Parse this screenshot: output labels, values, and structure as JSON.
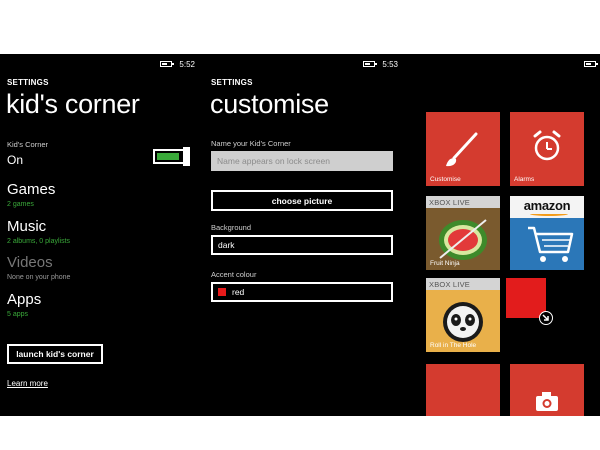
{
  "screen1": {
    "status_time": "5:52",
    "section": "SETTINGS",
    "title": "kid's corner",
    "toggle_label": "Kid's Corner",
    "toggle_state": "On",
    "items": [
      {
        "title": "Games",
        "subtitle": "2 games"
      },
      {
        "title": "Music",
        "subtitle": "2 albums, 0 playlists"
      },
      {
        "title": "Videos",
        "subtitle": "None on your phone"
      },
      {
        "title": "Apps",
        "subtitle": "5 apps"
      }
    ],
    "launch_button": "launch kid's corner",
    "learn_more": "Learn more"
  },
  "screen2": {
    "status_time": "5:53",
    "section": "SETTINGS",
    "title": "customise",
    "name_label": "Name your Kid's Corner",
    "name_placeholder": "Name appears on lock screen",
    "choose_picture": "choose picture",
    "background_label": "Background",
    "background_value": "dark",
    "accent_label": "Accent colour",
    "accent_value": "red"
  },
  "screen3": {
    "tiles": {
      "customise": "Customise",
      "alarms": "Alarms",
      "xbox1_header": "XBOX LIVE",
      "xbox1_label": "Fruit Ninja",
      "amazon_text": "amazon",
      "xbox2_header": "XBOX LIVE",
      "xbox2_label": "Roll in The Hole"
    }
  },
  "colors": {
    "accent_red": "#d43b2f",
    "toggle_green": "#3aa93a",
    "amazon_blue": "#2b77b8"
  }
}
